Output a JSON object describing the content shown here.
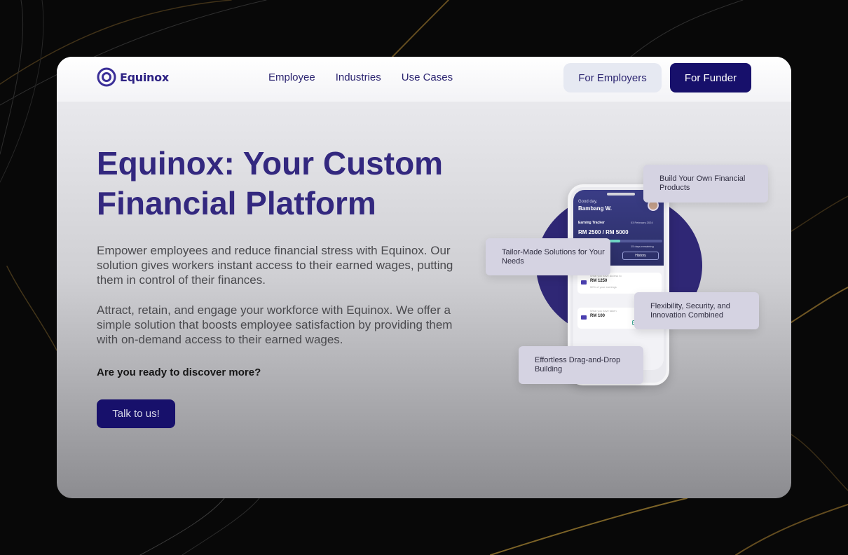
{
  "brand": {
    "name": "Equinox",
    "color": "#2e2384"
  },
  "nav": {
    "links": [
      "Employee",
      "Industries",
      "Use Cases"
    ],
    "employers_label": "For Employers",
    "funder_label": "For Funder"
  },
  "hero": {
    "title": "Equinox: Your Custom Financial Platform",
    "paragraph1": "Empower employees and reduce financial stress with Equinox. Our solution gives workers instant access to their earned wages, putting them in control of their finances.",
    "paragraph2": "Attract, retain, and engage your workforce with Equinox. We offer a simple solution that boosts employee satisfaction by providing them with on-demand access to their earned wages.",
    "question": "Are you ready to discover more?",
    "cta_label": "Talk to us!"
  },
  "features": [
    "Build Your Own Financial Products",
    "Tailor-Made Solutions for Your Needs",
    "Flexibility, Security, and Innovation Combined",
    "Effortless Drag-and-Drop Building"
  ],
  "phone": {
    "greeting": "Good day,",
    "user_name": "Bambang W.",
    "tracker_label": "Earning Tracker",
    "tracker_date": "03 February 2024",
    "amount": "RM 2500 / RM 5000",
    "progress": 0.5,
    "days_remaining": "15 days remaining",
    "history_label": "History",
    "rows": [
      {
        "caption": "What you have access to",
        "value": "RM 1250",
        "note": "50% of your earnings"
      },
      {
        "caption": "What you have taken",
        "value": "RM 100",
        "tag": "Last Transaction"
      }
    ]
  },
  "colors": {
    "primary": "#17106b",
    "heading": "#33287f",
    "secondary_button": "#e6e9f2"
  }
}
